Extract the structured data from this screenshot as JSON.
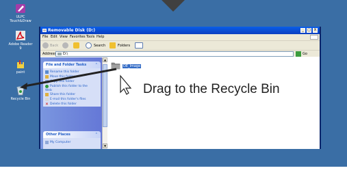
{
  "desktop": {
    "icons": [
      {
        "name": "ULPC Touch&Draw",
        "label": "ULPC\nTouch&Draw"
      },
      {
        "name": "Adobe Reader 9",
        "label": "Adobe Reader\n9"
      },
      {
        "name": "paint",
        "label": "paint"
      },
      {
        "name": "Recycle Bin",
        "label": "Recycle Bin"
      }
    ]
  },
  "window": {
    "title": "Removable Disk (D:)",
    "controls": {
      "minimize": "_",
      "maximize": "□",
      "close": "X"
    },
    "menu": [
      "File",
      "Edit",
      "View",
      "Favorites",
      "Tools",
      "Help"
    ],
    "toolbar": {
      "back": "Back",
      "search": "Search",
      "folders": "Folders"
    },
    "address": {
      "label": "Address",
      "value": "D:\\",
      "go": "Go"
    },
    "task_groups": [
      {
        "title": "File and Folder Tasks",
        "items": [
          "Rename this folder",
          "Move this folder",
          "Copy this folder",
          "Publish this folder to the Web",
          "Share this folder",
          "E-mail this folder's files",
          "Delete this folder"
        ]
      },
      {
        "title": "Other Places",
        "items": [
          "My Computer"
        ]
      }
    ],
    "folder": {
      "name": "DE_Image"
    }
  },
  "instruction": "Drag to the Recycle Bin",
  "colors": {
    "desktop": "#3a6ea5",
    "titlebar": "#0a4fd8",
    "taskpane": "#7a96df",
    "selection": "#316ac5"
  }
}
